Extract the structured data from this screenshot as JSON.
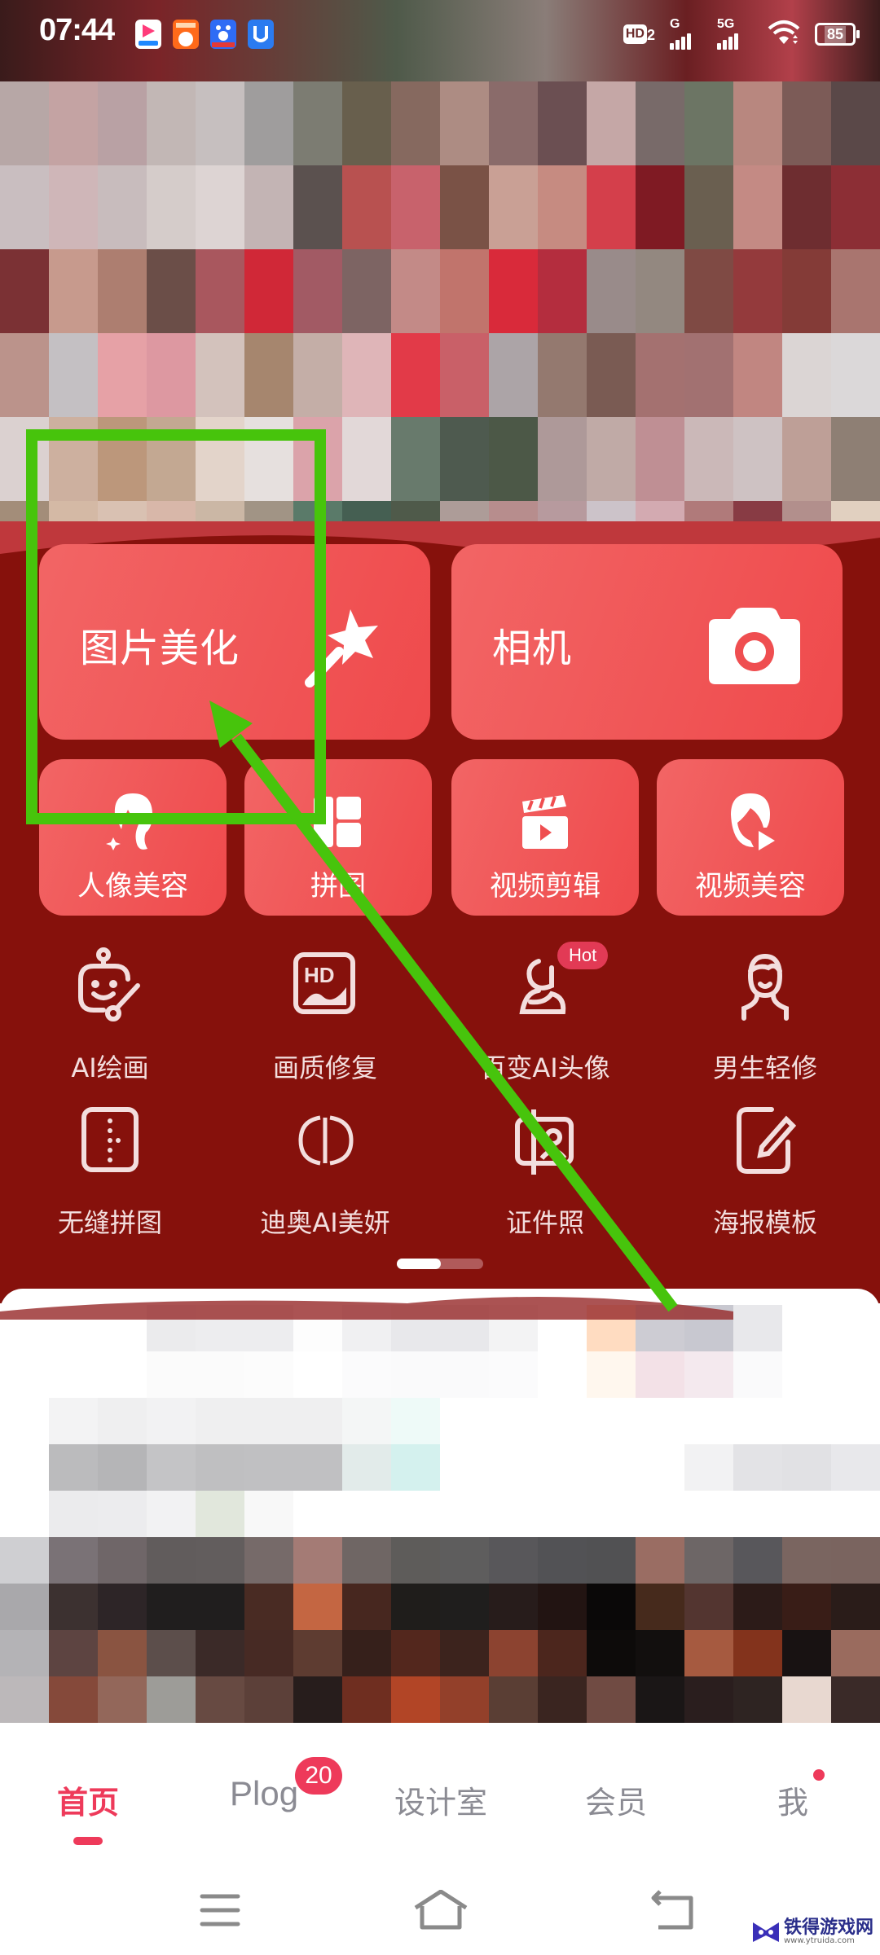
{
  "status_bar": {
    "time": "07:44",
    "notification_apps": [
      {
        "name": "video-app",
        "color": "#1e88ff"
      },
      {
        "name": "shopping-app",
        "color": "#ff6a1a"
      },
      {
        "name": "baidu-app",
        "color": "#2f6cf5"
      },
      {
        "name": "security-app",
        "color": "#2b7bf0"
      }
    ],
    "hd_label": "HD",
    "hd_sim": "2",
    "network_1": "G",
    "network_2": "5G",
    "battery": "85"
  },
  "banner": {
    "description": "pixelated banner image",
    "palette": [
      "#b7a7a6",
      "#c4a3a3",
      "#b9a1a4",
      "#c2b7b5",
      "#c6bfbf",
      "#9f9d9d",
      "#7c7c72",
      "#685f4d",
      "#86695f",
      "#ad8c83",
      "#8a6b6a",
      "#6b4f52",
      "#c5a7a6",
      "#786a69",
      "#6c7564",
      "#b8877f",
      "#7c5b57",
      "#5a4848",
      "#c9bec0",
      "#cfb6b8",
      "#c8bcbd",
      "#d5ccca",
      "#ddd4d3",
      "#c3b4b4",
      "#5b514f",
      "#b85150",
      "#c8626c",
      "#7a5246",
      "#c9a095",
      "#c68b81",
      "#d43f4b",
      "#7f1a23",
      "#6a5f50",
      "#c48a84",
      "#6e2d30",
      "#8c2e35",
      "#7b3134",
      "#c79a8d",
      "#ad7e70",
      "#6b4e48",
      "#a9575e",
      "#d02837",
      "#a25a64",
      "#7d6463",
      "#c38a87",
      "#c1746c",
      "#d92a3a",
      "#b42d3e",
      "#998b8a",
      "#938880",
      "#7f4a44",
      "#943a3c",
      "#843b37",
      "#a9756f",
      "#bb938b",
      "#c4c0c3",
      "#e6a1a6",
      "#dd98a1",
      "#d3c2bc",
      "#a6866e",
      "#c4aea7",
      "#dfb5b8",
      "#e23a48",
      "#c96068",
      "#aca4a7",
      "#94796f",
      "#7a5b53",
      "#a47170",
      "#a27171",
      "#c18681",
      "#dbd5d4",
      "#dbd8d9",
      "#dbd1d0",
      "#cdb09f",
      "#bc977b",
      "#c3a892",
      "#e3d4ca",
      "#e6e0de",
      "#dba3aa",
      "#e2d8d8",
      "#687a6c",
      "#4e5a4f",
      "#4c5847",
      "#ae9999",
      "#c0aaa6",
      "#bf8f94",
      "#cbb8b8",
      "#cec2c3",
      "#be9f97",
      "#8e7f74",
      "#a38d79",
      "#d4b9a5",
      "#d9c1b2",
      "#d8b7a9",
      "#cbb7a5",
      "#a19485",
      "#5a7a69",
      "#455f52",
      "#4f5a4a",
      "#ad9c98",
      "#b78d8d",
      "#b79a9e",
      "#ccc3c9",
      "#d3aab1",
      "#b07a7a",
      "#883b44",
      "#b28f8c",
      "#e1d0c0",
      "#cdb8ab",
      "#d9bbb1",
      "#c19f7e",
      "#7a6259",
      "#66776a",
      "#60695e",
      "#4d4b3d",
      "#8b5350",
      "#9c6a66",
      "#a57e7e",
      "#d6b6b8",
      "#d24c5a",
      "#920b1a",
      "#9b5457",
      "#d4bea8",
      "#e2d2c2",
      "#d5c2b9",
      "#e1cfc2",
      "#cfbb9b",
      "#b09a90",
      "#c4bcac",
      "#b2afa9",
      "#5c3432",
      "#802a30",
      "#7e3033",
      "#c49799",
      "#e2c4c7",
      "#e04a5c",
      "#c52e3c",
      "#c4a699",
      "#ddd0bc",
      "#dfd0bf",
      "#d5c5b5",
      "#d6c8af",
      "#cfbfa0",
      "#c5beb2",
      "#c5bdaf",
      "#bdb7ad"
    ]
  },
  "big_cards": [
    {
      "label": "图片美化",
      "icon": "magic-wand-icon"
    },
    {
      "label": "相机",
      "icon": "camera-icon"
    }
  ],
  "mid_cards": [
    {
      "label": "人像美容",
      "icon": "portrait-icon"
    },
    {
      "label": "拼图",
      "icon": "collage-icon"
    },
    {
      "label": "视频剪辑",
      "icon": "clapperboard-icon"
    },
    {
      "label": "视频美容",
      "icon": "video-portrait-icon"
    }
  ],
  "tools_row_1": [
    {
      "label": "AI绘画",
      "icon": "robot-paint-icon"
    },
    {
      "label": "画质修复",
      "icon": "hd-image-icon"
    },
    {
      "label": "百变AI头像",
      "icon": "ai-avatar-icon",
      "badge": "Hot"
    },
    {
      "label": "男生轻修",
      "icon": "male-face-icon"
    }
  ],
  "tools_row_2": [
    {
      "label": "无缝拼图",
      "icon": "seamless-collage-icon"
    },
    {
      "label": "迪奥AI美妍",
      "icon": "dior-icon"
    },
    {
      "label": "证件照",
      "icon": "id-photo-icon"
    },
    {
      "label": "海报模板",
      "icon": "poster-edit-icon"
    }
  ],
  "page_indicator": {
    "pages": 2,
    "active": 1
  },
  "feed": {
    "description": "pixelated content feed",
    "palette": [
      "#ffffff",
      "#ffffff",
      "#ffffff",
      "#ebebed",
      "#ededef",
      "#ededef",
      "#fdfdfd",
      "#f0f0f2",
      "#e8e8eb",
      "#e8e8eb",
      "#f3f3f4",
      "#ffffff",
      "#ffdcc1",
      "#cdccd3",
      "#c8c8d0",
      "#e8e8eb",
      "#ffffff",
      "#ffffff",
      "#ffffff",
      "#ffffff",
      "#ffffff",
      "#fbfbfb",
      "#fbfbfb",
      "#fcfcfc",
      "#ffffff",
      "#fbfbfc",
      "#fafafb",
      "#fafafb",
      "#fbfbfc",
      "#ffffff",
      "#fff7ee",
      "#f3e1e7",
      "#f4e9ee",
      "#fafafb",
      "#ffffff",
      "#ffffff",
      "#ffffff",
      "#f3f3f4",
      "#efeff0",
      "#f2f2f3",
      "#efeff0",
      "#efeff0",
      "#efeff0",
      "#f4f6f6",
      "#eefaf8",
      "#ffffff",
      "#ffffff",
      "#ffffff",
      "#ffffff",
      "#ffffff",
      "#ffffff",
      "#ffffff",
      "#ffffff",
      "#ffffff",
      "#ffffff",
      "#bbbbbd",
      "#b5b5b7",
      "#c4c4c6",
      "#bfbfc1",
      "#c0c0c2",
      "#c0c0c2",
      "#e2ebea",
      "#d4f1ee",
      "#ffffff",
      "#ffffff",
      "#ffffff",
      "#ffffff",
      "#ffffff",
      "#f2f2f3",
      "#e3e3e6",
      "#e1e1e4",
      "#e8e8eb",
      "#ffffff",
      "#ebebed",
      "#ececee",
      "#f2f2f3",
      "#e1e7dc",
      "#f8f8f8",
      "#ffffff",
      "#ffffff",
      "#ffffff",
      "#ffffff",
      "#ffffff",
      "#ffffff",
      "#ffffff",
      "#ffffff",
      "#ffffff",
      "#ffffff",
      "#ffffff",
      "#ffffff",
      "#cfcfd2",
      "#7a7276",
      "#6f6668",
      "#615c5c",
      "#625d5d",
      "#766a69",
      "#a47b75",
      "#6f6664",
      "#5e5c5a",
      "#5e5d5d",
      "#58575a",
      "#525255",
      "#515153",
      "#9a6d63",
      "#6d6666",
      "#58575b",
      "#7a6560",
      "#7a645f",
      "#a9a8ab",
      "#3c3130",
      "#2d2527",
      "#201e1e",
      "#201e1e",
      "#492b23",
      "#c46642",
      "#47271f",
      "#1f1d1b",
      "#1f1e1d",
      "#271c1b",
      "#221412",
      "#0a0808",
      "#462a1c",
      "#533530",
      "#2c1b18",
      "#391d17",
      "#2a1c19",
      "#b4b3b6",
      "#5d4441",
      "#8a5441",
      "#5c4e4b",
      "#3b2a28",
      "#472a24",
      "#5e3c31",
      "#36201b",
      "#53271d",
      "#3c231d",
      "#8c4330",
      "#4c261d",
      "#0d0b0a",
      "#120f0e",
      "#a65a40",
      "#83331c",
      "#181212",
      "#9a6b5e",
      "#bcb8ba",
      "#85493a",
      "#93675a",
      "#9d9c98",
      "#674a42",
      "#5c4039",
      "#271d1c",
      "#6f2e20",
      "#b24526",
      "#93402a",
      "#5a3e34",
      "#3a2520",
      "#704b43",
      "#1a1616",
      "#2a1e1e",
      "#2e2422",
      "#e8d8d0",
      "#3a2a28"
    ]
  },
  "bottom_nav": {
    "items": [
      {
        "label": "首页",
        "active": true
      },
      {
        "label": "Plog",
        "badge": "20"
      },
      {
        "label": "设计室"
      },
      {
        "label": "会员"
      },
      {
        "label": "我",
        "dot": true
      }
    ]
  },
  "system_nav": {
    "buttons": [
      "menu-icon",
      "home-icon",
      "back-icon"
    ]
  },
  "watermark": {
    "title": "铁得游戏网",
    "url": "www.ytruida.com"
  },
  "annotation": {
    "color": "#47c40c",
    "target": "图片美化"
  },
  "colors": {
    "panel_bg": "#86110c",
    "card_start": "#f26565",
    "card_end": "#ef4a4c",
    "accent": "#ee3a5a",
    "nav_inactive": "#8b8b93"
  }
}
